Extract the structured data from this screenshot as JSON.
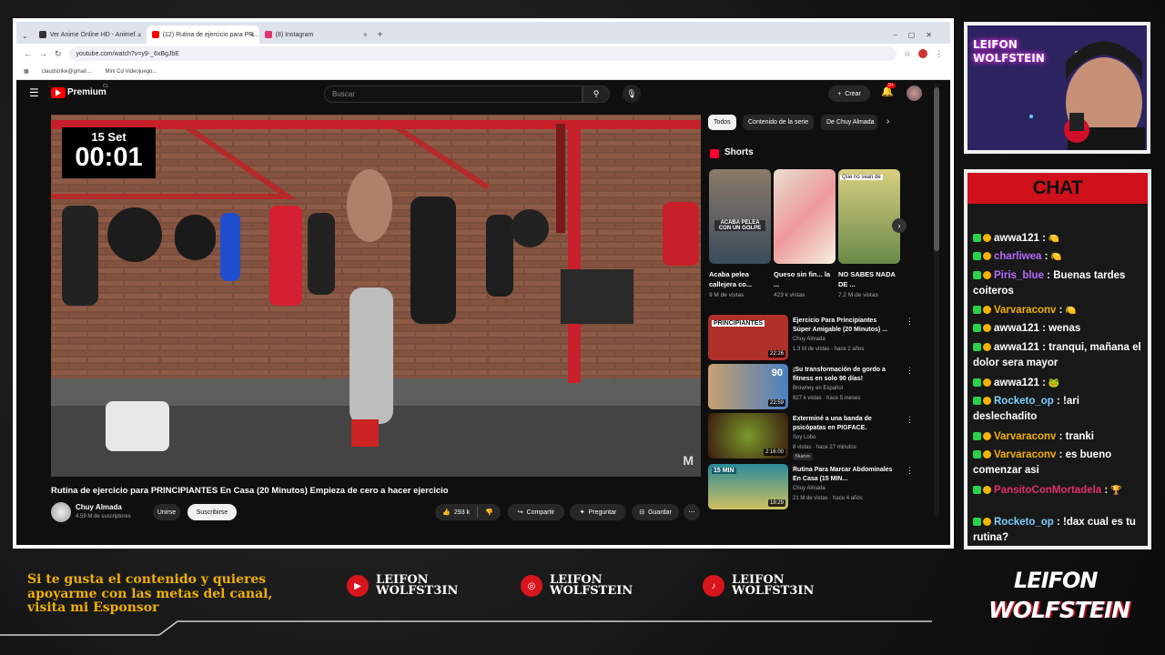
{
  "browser": {
    "tabs": [
      {
        "label": "Ver Anime Online HD - Animef...",
        "icon_color": "#333333"
      },
      {
        "label": "(12) Rutina de ejercicio para PR...",
        "icon_color": "#ff0000"
      },
      {
        "label": "(8) Instagram",
        "icon_color": "#e1306c"
      }
    ],
    "url": "youtube.com/watch?v=y9-_6xBgJbE",
    "bookmarks": [
      "claudstrike@gmail....",
      "Mini Cd Videojuego..."
    ]
  },
  "youtube": {
    "brand": "Premium",
    "brand_sup": "CL",
    "search_placeholder": "Buscar",
    "create_label": "Crear",
    "notif_count": "9+",
    "video": {
      "date_label": "15 Set",
      "timer": "00:01",
      "watermark": "M",
      "title": "Rutina de ejercicio para PRINCIPIANTES En Casa (20 Minutos) Empieza de cero a hacer ejercicio"
    },
    "channel": {
      "name": "Chuy Almada",
      "subs": "4.59 M de suscriptores",
      "join": "Unirse",
      "subscribe": "Suscribirse"
    },
    "actions": {
      "likes": "293 k",
      "share": "Compartir",
      "ask": "Preguntar",
      "save": "Guardar"
    },
    "chips": [
      "Todos",
      "Contenido de la serie",
      "De Chuy Almada"
    ],
    "shorts_title": "Shorts",
    "shorts": [
      {
        "title": "Acaba pelea callejera co...",
        "views": "9 M de vistas",
        "overlay": "ACABA PELEA CON UN GOLPE"
      },
      {
        "title": "Queso sin fin... la ...",
        "views": "423 k vistas",
        "overlay": ""
      },
      {
        "title": "NO SABES NADA DE ...",
        "views": "7.2 M de vistas",
        "overlay": "Que no sean de"
      }
    ],
    "recommended": [
      {
        "title": "Ejercicio Para Principiantes Súper Amigable (20 Minutos) ...",
        "channel": "Chuy Almada",
        "meta": "1.3 M de vistas · hace 2 años",
        "duration": "22:26",
        "thumb_text": "PRINCIPIANTES",
        "badge": "",
        "color": "#b0302a"
      },
      {
        "title": "¡Su transformación de gordo a fitness en solo 90 días!",
        "channel": "Browney en Español",
        "meta": "827 k vistas · hace 5 meses",
        "duration": "22:59",
        "thumb_text": "90",
        "badge": "",
        "color": "#c8a070"
      },
      {
        "title": "Exterminé a una banda de psicópatas en PIGFACE.",
        "channel": "Soy Lobo",
        "meta": "8 vistas · hace 27 minutos",
        "duration": "2:16:00",
        "thumb_text": "",
        "badge": "Nuevo",
        "color": "#3a6a20"
      },
      {
        "title": "Rutina Para Marcar Abdominales En Casa (15 MIN...",
        "channel": "Chuy Almada",
        "meta": "21 M de vistas · hace 4 años",
        "duration": "18:29",
        "thumb_text": "15 MIN",
        "badge": "",
        "color": "#2a8a9a"
      }
    ]
  },
  "webcam": {
    "overlay_line1": "LEIFON",
    "overlay_line2": "WOLFSTEIN"
  },
  "chat": {
    "header": "CHAT",
    "messages": [
      {
        "user": "awwa121",
        "text": ":",
        "emote": "🍋",
        "user_color": "#ffffff"
      },
      {
        "user": "charliwea",
        "text": ":",
        "emote": "🍋",
        "user_color": "#b46cff"
      },
      {
        "user": "Piris_blue",
        "text": ": Buenas tardes coiteros",
        "emote": "",
        "user_color": "#b46cff"
      },
      {
        "user": "Varvaraconv",
        "text": ":",
        "emote": "🍋",
        "user_color": "#f0b000"
      },
      {
        "user": "awwa121",
        "text": ": wenas",
        "emote": "",
        "user_color": "#ffffff"
      },
      {
        "user": "awwa121",
        "text": ": tranqui, mañana el dolor sera mayor",
        "emote": "",
        "user_color": "#ffffff"
      },
      {
        "user": "awwa121",
        "text": ":",
        "emote": "🐸",
        "user_color": "#ffffff"
      },
      {
        "user": "Rocketo_op",
        "text": ": !ari deslechadito",
        "emote": "",
        "user_color": "#7fd0ff"
      },
      {
        "user": "Varvaraconv",
        "text": ": tranki",
        "emote": "",
        "user_color": "#f0b000"
      },
      {
        "user": "Varvaraconv",
        "text": ": es bueno comenzar asi",
        "emote": "",
        "user_color": "#f0b000"
      },
      {
        "user": "PansitoConMortadela",
        "text": ":",
        "emote": "🏆",
        "user_color": "#e0306a"
      },
      {
        "user": "Rocketo_op",
        "text": ": !dax cual es tu rutina?",
        "emote": "",
        "user_color": "#7fd0ff"
      }
    ]
  },
  "footer": {
    "sponsor_text": "Si te gusta el contenido y quieres apoyarme con las metas del canal, visita mi Esponsor",
    "socials": [
      {
        "icon": "youtube-icon",
        "line1": "LEIFON",
        "line2": "WOLFST3IN"
      },
      {
        "icon": "instagram-icon",
        "line1": "LEIFON",
        "line2": "WOLFSTEIN"
      },
      {
        "icon": "tiktok-icon",
        "line1": "LEIFON",
        "line2": "WOLFST3IN"
      }
    ],
    "logo_line1": "LEIFON",
    "logo_line2": "WOLFSTEIN"
  }
}
